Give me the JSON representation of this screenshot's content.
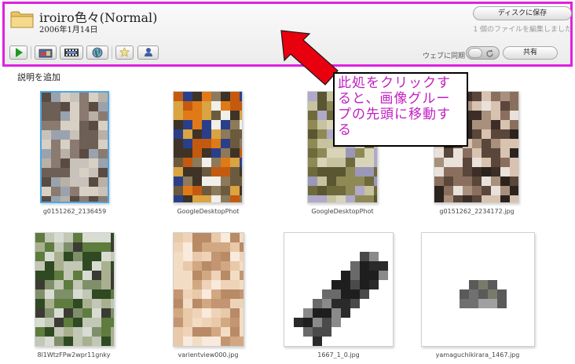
{
  "album": {
    "title": "iroiro色々(Normal)",
    "date": "2006年1月14日"
  },
  "actions": {
    "save_label": "ディスクに保存",
    "edit_status": "1 個のファイルを編集しました",
    "sync_label": "ウェブに同期",
    "share_label": "共有",
    "add_caption": "説明を追加"
  },
  "toolbar": {
    "buttons": [
      {
        "name": "slideshow",
        "icon": "play-icon"
      },
      {
        "name": "import",
        "icon": "photo-import-icon"
      },
      {
        "name": "movie",
        "icon": "film-icon"
      },
      {
        "name": "globe",
        "icon": "globe-icon"
      },
      {
        "name": "star",
        "icon": "star-icon"
      },
      {
        "name": "people",
        "icon": "person-icon"
      }
    ]
  },
  "photos": [
    {
      "filename": "g0151262_2136459"
    },
    {
      "filename": "GoogleDesktopPhot"
    },
    {
      "filename": "GoogleDesktopPhot"
    },
    {
      "filename": "g0151262_2234172.jpg"
    },
    {
      "filename": "8l1WtzFPw2wpr11gnky"
    },
    {
      "filename": "varientview000.jpg"
    },
    {
      "filename": "1667_1_0.jpg"
    },
    {
      "filename": "yamaguchikirara_1467.jpg"
    }
  ],
  "annotation": {
    "text": "此処をクリックすると、画像グループの先頭に移動する"
  },
  "colors": {
    "highlight_border": "#e020e0",
    "annotation_text": "#c020c0",
    "arrow_fill": "#e8000f",
    "selection_border": "#4aa8e8"
  }
}
